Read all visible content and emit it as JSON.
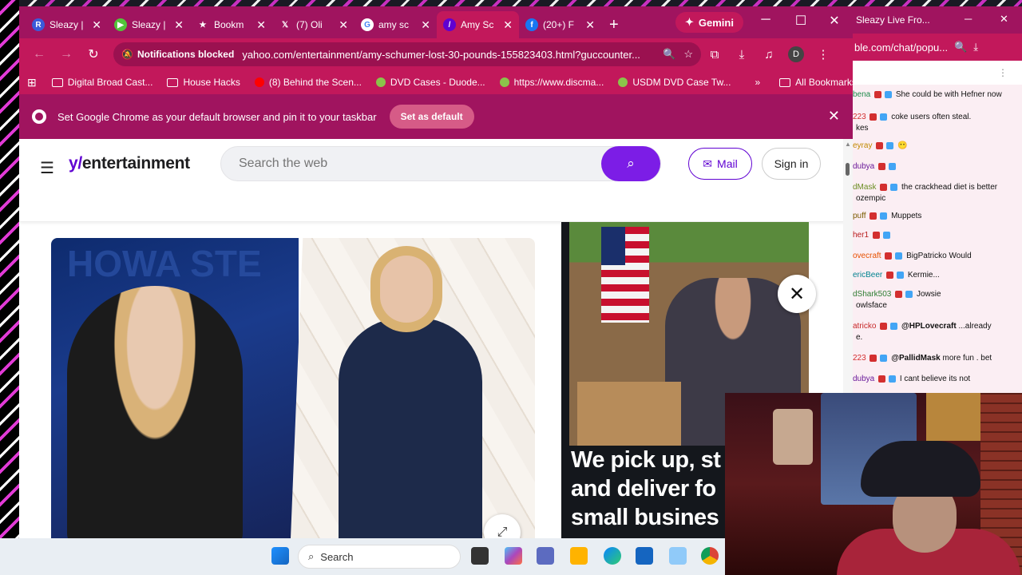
{
  "tabs": [
    {
      "label": "Sleazy |",
      "fav_bg": "#3b5bd9",
      "fav_glyph": "R"
    },
    {
      "label": "Sleazy |",
      "fav_bg": "#53c33a",
      "fav_glyph": "▶"
    },
    {
      "label": "Bookm",
      "fav_bg": "transparent",
      "fav_glyph": "★"
    },
    {
      "label": "(7) Oli",
      "fav_bg": "transparent",
      "fav_glyph": "𝕏"
    },
    {
      "label": "amy sc",
      "fav_bg": "#ffffff",
      "fav_glyph": "G"
    },
    {
      "label": "Amy Sc",
      "fav_bg": "#6001d2",
      "fav_glyph": "/"
    },
    {
      "label": "(20+) F",
      "fav_bg": "#1877f2",
      "fav_glyph": "f"
    }
  ],
  "new_tab": "+",
  "gemini_label": "Gemini",
  "toolbar": {
    "notifications_blocked": "Notifications blocked",
    "url": "yahoo.com/entertainment/amy-schumer-lost-30-pounds-155823403.html?guccounter...",
    "profile_initial": "D"
  },
  "bookmarks": [
    {
      "label": "Digital Broad Cast...",
      "icon": "folder-icon"
    },
    {
      "label": "House Hacks",
      "icon": "folder-icon"
    },
    {
      "label": "(8) Behind the Scen...",
      "icon": "youtube-icon"
    },
    {
      "label": "DVD Cases - Duode...",
      "icon": "site-icon"
    },
    {
      "label": "https://www.discma...",
      "icon": "site-icon"
    },
    {
      "label": "USDM DVD Case Tw...",
      "icon": "site-icon"
    }
  ],
  "bookmarks_more": "»",
  "all_bookmarks": "All Bookmarks",
  "infobar": {
    "message": "Set Google Chrome as your default browser and pin it to your taskbar",
    "button": "Set as default"
  },
  "yahoo": {
    "logo_y": "y/",
    "logo_text": "entertainment",
    "search_placeholder": "Search the web",
    "mail_label": "Mail",
    "signin_label": "Sign in"
  },
  "photo_bg_text": "HOWA STE",
  "ad": {
    "line1": "We pick up, st",
    "line2": "and deliver fo",
    "line3": "small busines"
  },
  "chat": {
    "window_title": "Sleazy Live Fro...",
    "url": "ble.com/chat/popu...",
    "messages": [
      {
        "user": "bena",
        "user_color": "#1d8a4a",
        "text": "She could be with Hefner now"
      },
      {
        "user": "223",
        "user_color": "#d32f2f",
        "text": "coke users often steal."
      },
      {
        "user": "",
        "user_color": "#111",
        "text": "kes"
      },
      {
        "user": "eyray",
        "user_color": "#c08a00",
        "text": "😶"
      },
      {
        "user": "dubya",
        "user_color": "#6a1b9a",
        "text": ""
      },
      {
        "user": "dMask",
        "user_color": "#6b8e23",
        "text": "the crackhead diet is better"
      },
      {
        "user": "",
        "user_color": "#111",
        "text": "ozempic"
      },
      {
        "user": "puff",
        "user_color": "#7a5c00",
        "text": "Muppets"
      },
      {
        "user": "her1",
        "user_color": "#b71c1c",
        "text": ""
      },
      {
        "user": "ovecraft",
        "user_color": "#e65100",
        "text": "BigPatricko Would"
      },
      {
        "user": "ericBeer",
        "user_color": "#00838f",
        "text": "Kermie..."
      },
      {
        "user": "dShark503",
        "user_color": "#2e7d32",
        "text": "Jowsie"
      },
      {
        "user": "",
        "user_color": "#111",
        "text": "owlsface"
      },
      {
        "user": "atricko",
        "user_color": "#c62828",
        "text": "...already",
        "mention": "@HPLovecraft"
      },
      {
        "user": "",
        "user_color": "#111",
        "text": "e."
      },
      {
        "user": "223",
        "user_color": "#d32f2f",
        "text": "more fun . bet",
        "mention": "@PallidMask"
      },
      {
        "user": "dubya",
        "user_color": "#6a1b9a",
        "text": "I cant believe its not"
      }
    ]
  },
  "taskbar": {
    "search_label": "Search"
  },
  "colors": {
    "chrome_dark": "#a0145f",
    "chrome_main": "#c2185b",
    "yahoo_purple": "#6001d2"
  }
}
